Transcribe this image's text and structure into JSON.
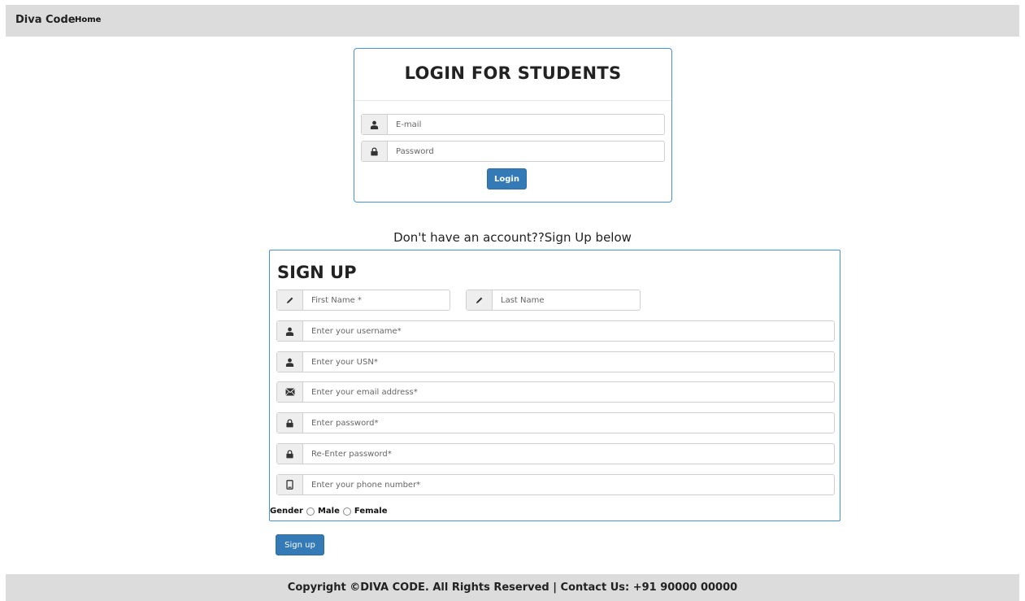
{
  "navbar": {
    "brand": "Diva Code",
    "home": "Home"
  },
  "login": {
    "title": "LOGIN FOR STUDENTS",
    "email_placeholder": "E-mail",
    "password_placeholder": "Password",
    "button": "Login"
  },
  "prompt": "Don't have an account??Sign Up below",
  "signup": {
    "title": "SIGN UP",
    "first_name_placeholder": "First Name *",
    "last_name_placeholder": "Last Name",
    "username_placeholder": "Enter your username*",
    "usn_placeholder": "Enter your USN*",
    "email_placeholder": "Enter your email address*",
    "password_placeholder": "Enter password*",
    "reenter_password_placeholder": "Re-Enter password*",
    "phone_placeholder": "Enter your phone number*",
    "gender_label": "Gender",
    "gender_options": [
      "Male",
      "Female"
    ],
    "button": "Sign up"
  },
  "footer": {
    "text": "Copyright ©DIVA CODE. All Rights Reserved | Contact Us: +91 90000 00000"
  },
  "colors": {
    "accent": "#337ab7",
    "panel_border": "#4a90d9",
    "bar_bg": "#dcdcdc"
  }
}
